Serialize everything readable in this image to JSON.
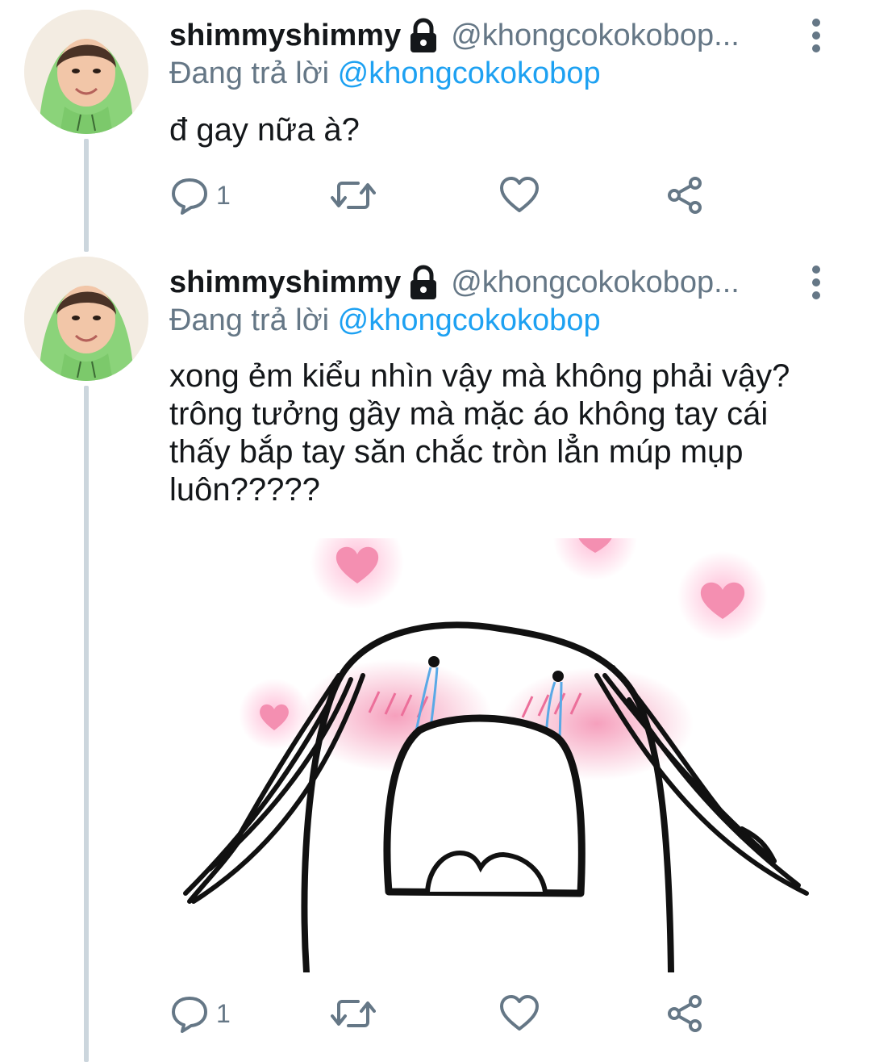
{
  "colors": {
    "text_primary": "#14171a",
    "text_secondary": "#657786",
    "mention": "#1da1f2",
    "thread_line": "#ccd6dd",
    "icon": "#657786",
    "heart_pink": "#f06292"
  },
  "tweets": [
    {
      "display_name": "shimmyshimmy",
      "handle": "@khongcokokobop...",
      "locked_icon": "lock-icon",
      "reply_prefix": "Đang trả lời",
      "reply_mention": "@khongcokokobop",
      "text": "đ gay nữa à?",
      "actions": {
        "reply_icon": "reply-icon",
        "reply_count": "1",
        "retweet_icon": "retweet-icon",
        "like_icon": "like-icon",
        "share_icon": "share-icon"
      }
    },
    {
      "display_name": "shimmyshimmy",
      "handle": "@khongcokokobop...",
      "locked_icon": "lock-icon",
      "reply_prefix": "Đang trả lời",
      "reply_mention": "@khongcokokobop",
      "text": "xong ẻm kiểu nhìn vậy mà không phải vậy? trông tưởng gầy mà mặc áo không tay cái thấy bắp tay săn chắc tròn lẳn múp mụp luôn?????",
      "has_media": true,
      "actions": {
        "reply_icon": "reply-icon",
        "reply_count": "1",
        "retweet_icon": "retweet-icon",
        "like_icon": "like-icon",
        "share_icon": "share-icon"
      }
    }
  ]
}
